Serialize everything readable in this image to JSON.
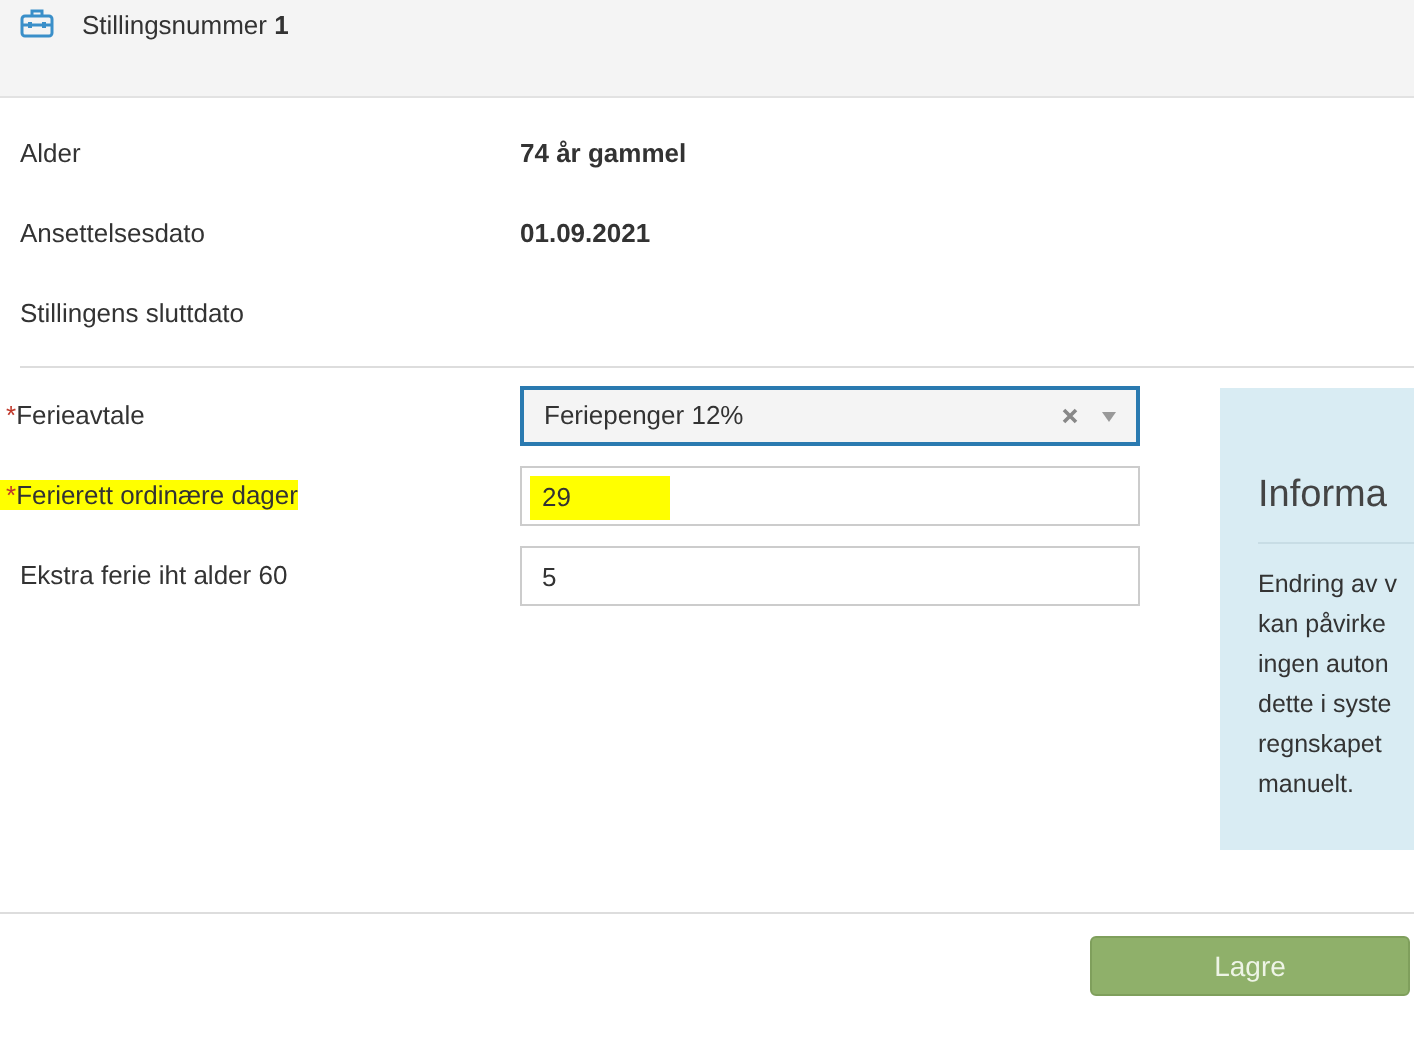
{
  "header": {
    "label": "Stillingsnummer",
    "number": "1"
  },
  "details": [
    {
      "label": "Alder",
      "value": "74 år gammel"
    },
    {
      "label": "Ansettelsesdato",
      "value": "01.09.2021"
    },
    {
      "label": "Stillingens sluttdato"
    }
  ],
  "form": [
    {
      "kind": "select",
      "label": "Ferieavtale",
      "required_mark": "*",
      "highlighted": false,
      "value": "Feriepenger 12%",
      "focused": true
    },
    {
      "kind": "input",
      "label": "Ferierett ordinære dager",
      "required_mark": "*",
      "highlighted": true,
      "value": "29",
      "focused": false
    },
    {
      "kind": "input",
      "label": "Ekstra ferie iht alder 60",
      "highlighted": false,
      "value": "5",
      "focused": false
    }
  ],
  "info": {
    "title": "Informa",
    "lines": [
      "Endring av v",
      "kan påvirke",
      "ingen auton",
      "dette i syste",
      "regnskapet",
      "manuelt."
    ]
  },
  "save_button": {
    "label": "Lagre"
  }
}
